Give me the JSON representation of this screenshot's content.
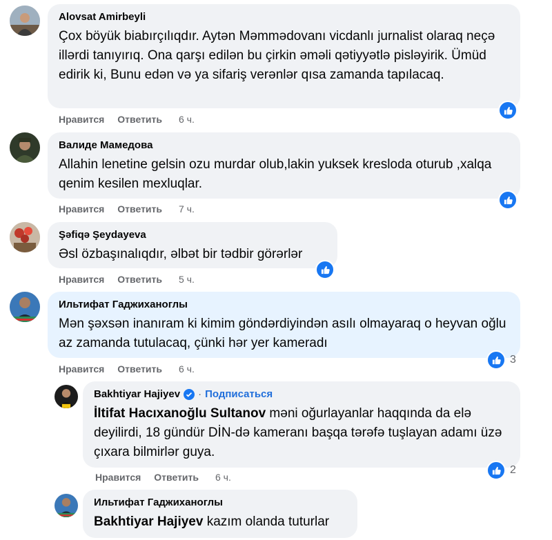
{
  "labels": {
    "like": "Нравится",
    "reply": "Ответить"
  },
  "comments": [
    {
      "author": "Alovsat Amirbeyli",
      "text": "Çox böyük biabırçılıqdır. Aytən Məmmədovanı vicdanlı jurnalist olaraq neçə illərdi tanıyırıq. Ona qarşı edilən bu çirkin əməli qətiyyətlə pisləyirik. Ümüd edirik ki, Bunu edən və ya sifariş verənlər qısa zamanda tapılacaq.",
      "time": "6 ч."
    },
    {
      "author": "Валиде Мамедова",
      "text": "Allahin lenetine gelsin ozu murdar olub,lakin yuksek kresloda oturub ,xalqa qenim kesilen mexluqlar.",
      "time": "7 ч."
    },
    {
      "author": "Şəfiqə Şeydayeva",
      "text": "Əsl özbaşınalıqdır, əlbət bir tədbir görərlər",
      "time": "5 ч."
    },
    {
      "author": "Ильтифат Гаджиханоглы",
      "text": "Mən şəxsən inanıram ki kimim göndərdiyindən asılı olmayaraq o heyvan oğlu az zamanda tutulacaq, çünki hər yer kameradı",
      "time": "6 ч.",
      "reactions": "3"
    }
  ],
  "replies": [
    {
      "author": "Bakhtiyar Hajiyev",
      "follow": "Подписаться",
      "mention": "İltifat Hacıxanoğlu Sultanov",
      "text": " məni oğurlayanlar haqqında da elə deyilirdi, 18 gündür DİN-də kameranı başqa tərəfə tuşlayan adamı üzə çıxara bilmirlər guya.",
      "time": "6 ч.",
      "reactions": "2"
    },
    {
      "author": "Ильтифат Гаджиханоглы",
      "mention": "Bakhtiyar Hajiyev",
      "text": " kazım olanda tuturlar"
    }
  ],
  "colors": {
    "bubble": "#f0f2f5",
    "bubble_highlight": "#e7f3ff",
    "like_blue": "#1877f2",
    "meta_grey": "#65676b",
    "link_blue": "#216fdb"
  },
  "icons": {
    "like": "thumbs-up-icon",
    "verified": "verified-badge-icon"
  }
}
